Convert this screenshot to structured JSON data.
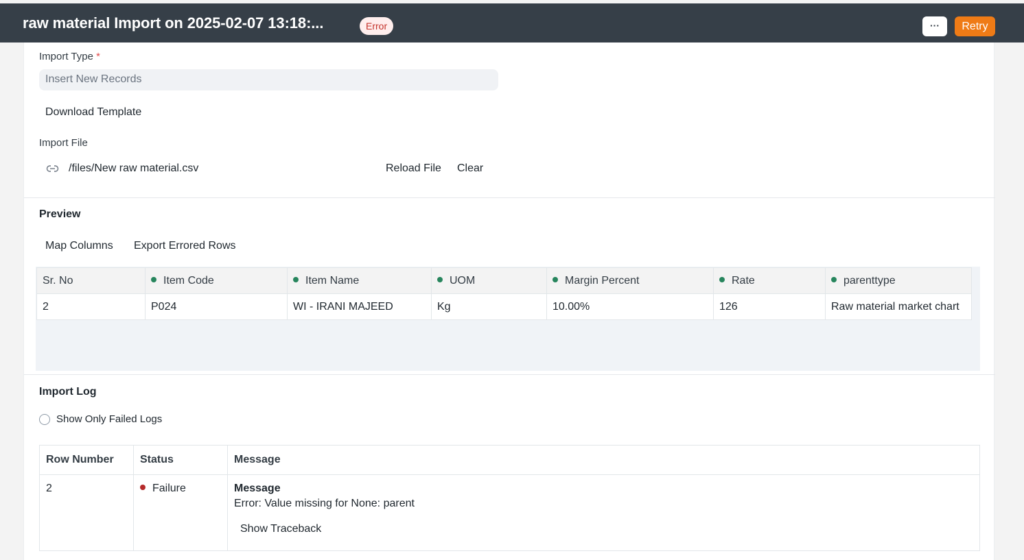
{
  "header": {
    "title": "raw material Import on 2025-02-07 13:18:...",
    "status_badge": "Error",
    "more_label": "···",
    "retry_label": "Retry"
  },
  "form": {
    "import_type_label": "Import Type",
    "required_mark": "*",
    "import_type_value": "Insert New Records",
    "download_template_label": "Download Template",
    "import_file_label": "Import File",
    "file_path": "/files/New raw material.csv",
    "reload_file_label": "Reload File",
    "clear_label": "Clear",
    "link_icon": "link-icon"
  },
  "preview": {
    "title": "Preview",
    "map_columns_label": "Map Columns",
    "export_errored_rows_label": "Export Errored Rows",
    "columns": [
      "Sr. No",
      "Item Code",
      "Item Name",
      "UOM",
      "Margin Percent",
      "Rate",
      "parenttype"
    ],
    "rows": [
      [
        "2",
        "P024",
        "WI - IRANI MAJEED",
        "Kg",
        "10.00%",
        "126",
        "Raw material market chart"
      ]
    ],
    "column_dot_color": "#27855d"
  },
  "import_log": {
    "title": "Import Log",
    "show_failed_label": "Show Only Failed Logs",
    "columns": [
      "Row Number",
      "Status",
      "Message"
    ],
    "rows": [
      {
        "row_number": "2",
        "status": "Failure",
        "message_title": "Message",
        "message_text": "Error: Value missing for None: parent",
        "show_traceback_label": "Show Traceback"
      }
    ],
    "failure_color": "#b52a2a"
  },
  "colors": {
    "topbar": "#363f48",
    "retry": "#ef7b16",
    "error_badge_bg": "#ffeeed",
    "error_badge_text": "#c4322a"
  }
}
